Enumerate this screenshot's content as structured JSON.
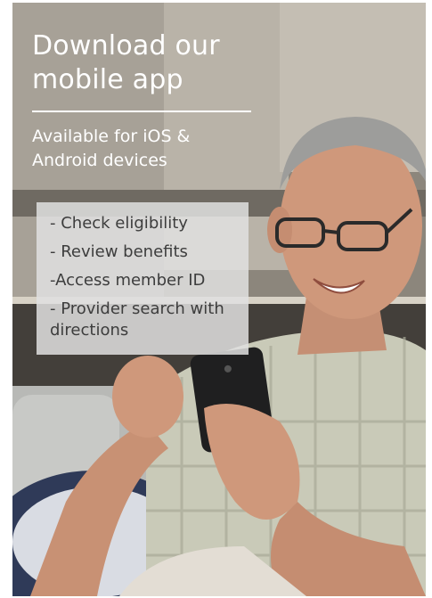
{
  "promo": {
    "title": "Download our mobile app",
    "subtitle": "Available for iOS & Android devices",
    "features": [
      "- Check eligibility",
      "- Review benefits",
      "-Access member ID",
      "- Provider search with directions"
    ]
  },
  "photo": {
    "subject": "older man using smartphone on couch"
  }
}
